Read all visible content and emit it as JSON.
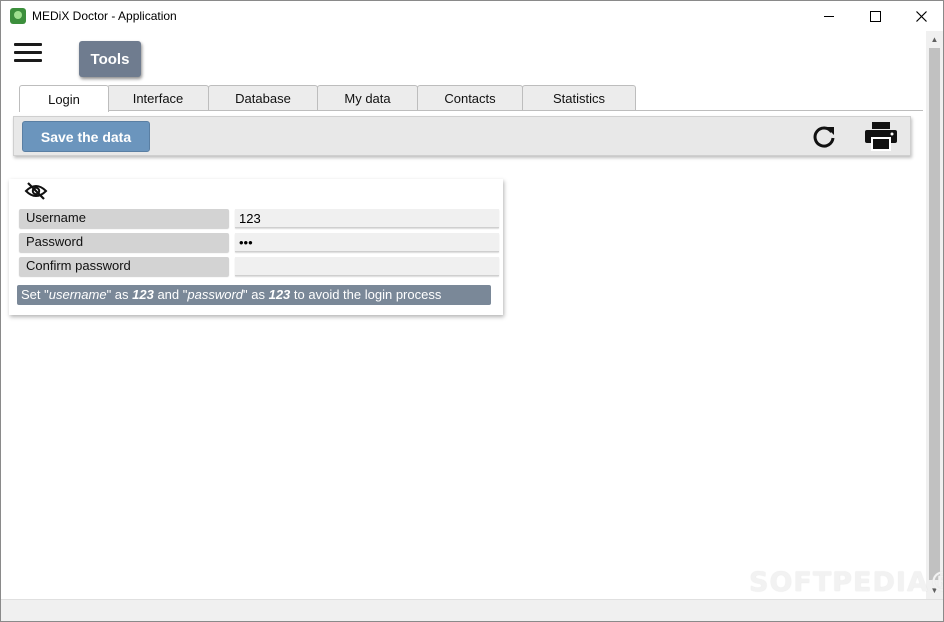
{
  "window": {
    "title": "MEDiX Doctor - Application",
    "minimize": "—",
    "maximize": "☐",
    "close": "✕"
  },
  "header": {
    "tools_label": "Tools"
  },
  "tabs": [
    {
      "label": "Login",
      "active": true
    },
    {
      "label": "Interface",
      "active": false
    },
    {
      "label": "Database",
      "active": false
    },
    {
      "label": "My data",
      "active": false
    },
    {
      "label": "Contacts",
      "active": false
    },
    {
      "label": "Statistics",
      "active": false
    }
  ],
  "toolbar": {
    "save_label": "Save the data",
    "refresh_icon": "refresh-icon",
    "print_icon": "print-icon"
  },
  "login_form": {
    "visibility_icon": "eye-off-icon",
    "username_label": "Username",
    "username_value": "123",
    "password_label": "Password",
    "password_value": "123",
    "confirm_label": "Confirm password",
    "confirm_value": "",
    "hint": {
      "part1": "Set \"",
      "username_word": "username",
      "part2": "\" as ",
      "value1": "123",
      "part3": " and \"",
      "password_word": "password",
      "part4": "\" as ",
      "value2": "123",
      "part5": " to avoid the login process"
    }
  },
  "watermark": "SOFTPEDIA®",
  "colors": {
    "tools_button": "#6f7c8f",
    "save_button": "#6b95bd",
    "hint_background": "#7a8898"
  }
}
